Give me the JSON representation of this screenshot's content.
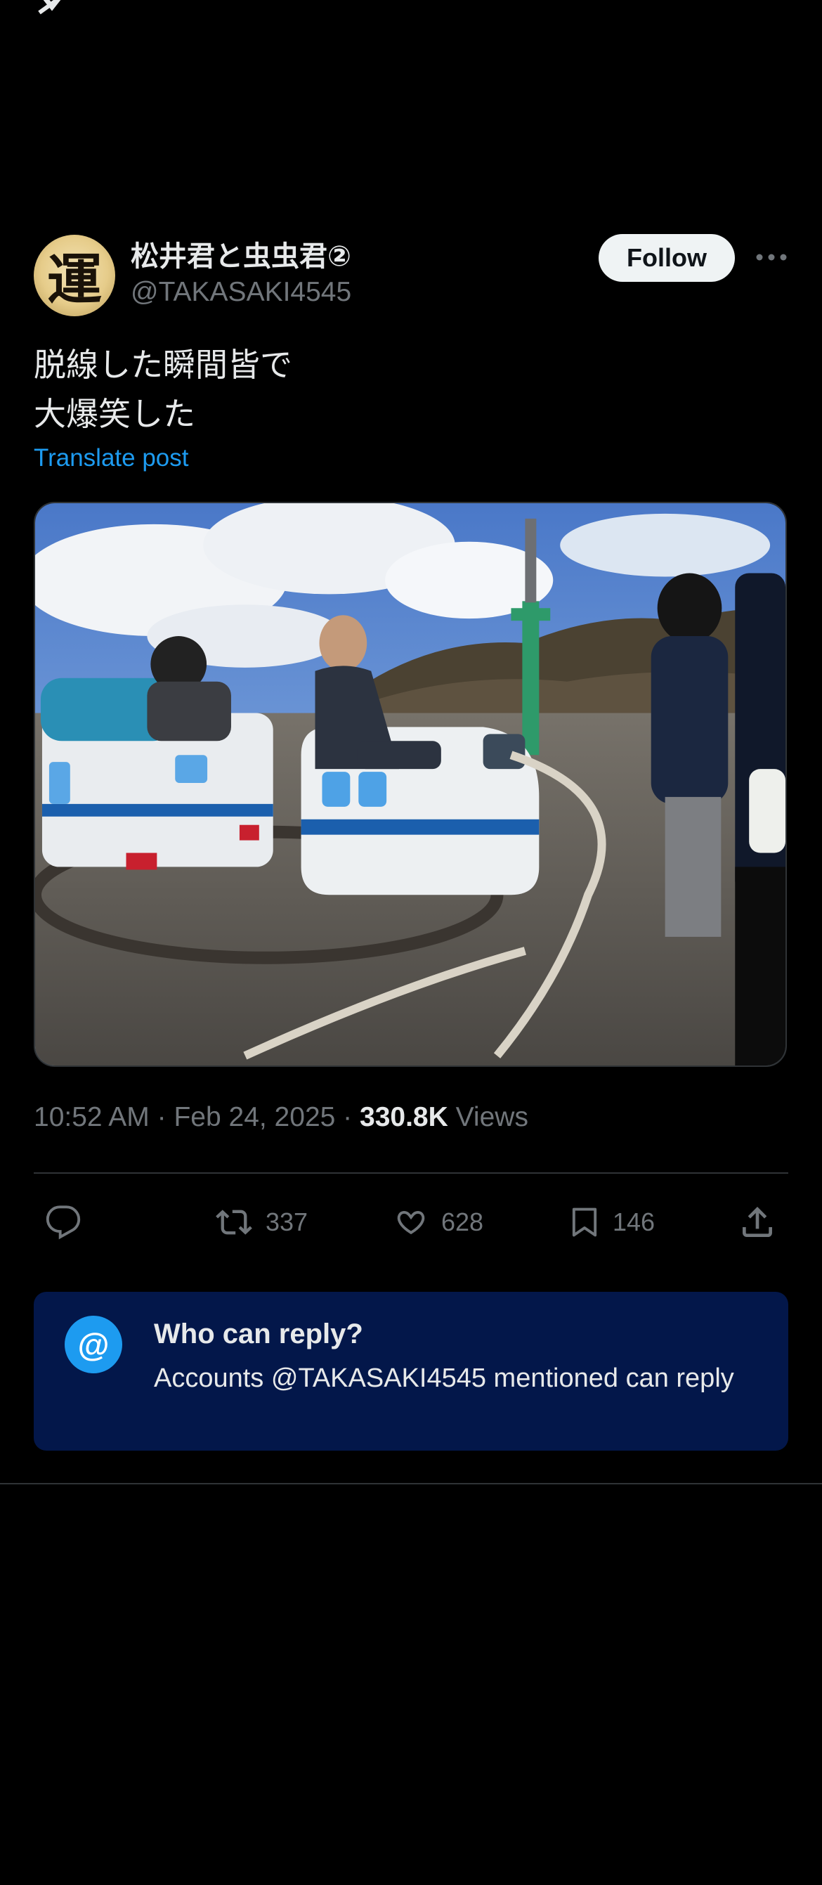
{
  "post": {
    "author": {
      "display_name": "松井君と虫虫君②",
      "handle": "@TAKASAKI4545",
      "avatar_glyph": "運"
    },
    "follow_label": "Follow",
    "text": "脱線した瞬間皆で\n大爆笑した",
    "translate_label": "Translate post",
    "time": "10:52 AM",
    "date": "Feb 24, 2025",
    "views_count": "330.8K",
    "views_label": "Views",
    "separator": "·"
  },
  "actions": {
    "reply_icon": "reply-icon",
    "retweet": {
      "icon": "retweet-icon",
      "count": "337"
    },
    "like": {
      "icon": "heart-icon",
      "count": "628"
    },
    "bookmark": {
      "icon": "bookmark-icon",
      "count": "146"
    },
    "share_icon": "share-icon"
  },
  "reply_settings": {
    "icon_text": "@",
    "title": "Who can reply?",
    "description": "Accounts @TAKASAKI4545 mentioned can reply"
  },
  "colors": {
    "background": "#000000",
    "text_primary": "#e7e9ea",
    "text_secondary": "#71767b",
    "accent": "#1d9bf0",
    "reply_box": "#03174a"
  }
}
